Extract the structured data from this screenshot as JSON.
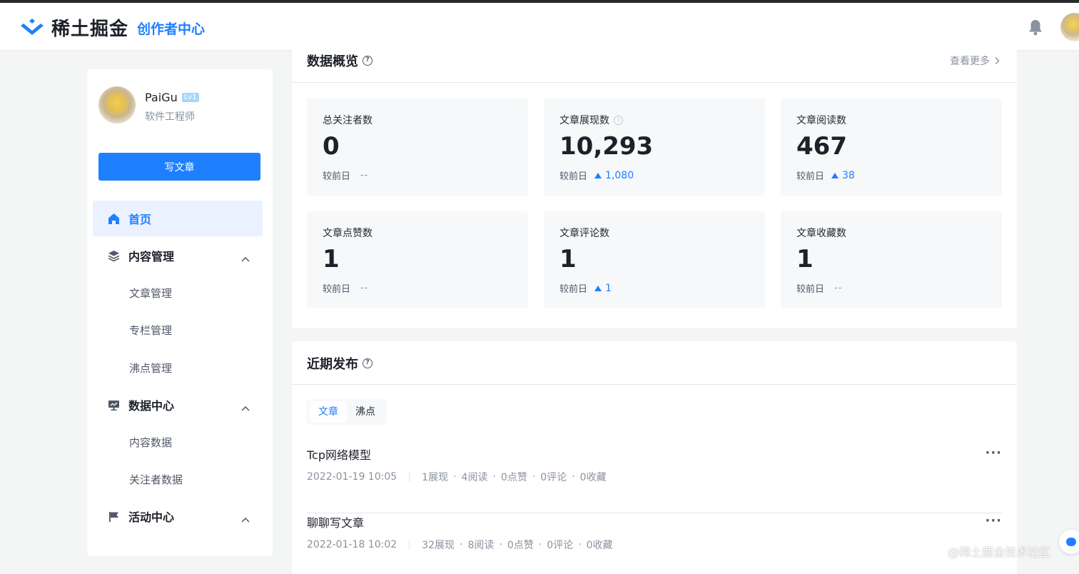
{
  "header": {
    "logo_text": "稀土掘金",
    "subtitle": "创作者中心",
    "brand_color": "#1e80ff"
  },
  "sidebar": {
    "user": {
      "name": "PaiGu",
      "level": "Lv1",
      "title": "软件工程师"
    },
    "write_button": "写文章",
    "nav": [
      {
        "label": "首页",
        "icon": "home-icon",
        "active": true
      },
      {
        "label": "内容管理",
        "icon": "layers-icon",
        "sub": [
          "文章管理",
          "专栏管理",
          "沸点管理"
        ]
      },
      {
        "label": "数据中心",
        "icon": "monitor-chart-icon",
        "sub": [
          "内容数据",
          "关注者数据"
        ]
      },
      {
        "label": "活动中心",
        "icon": "flag-icon"
      }
    ]
  },
  "overview": {
    "title": "数据概览",
    "more": "查看更多",
    "compare_label": "较前日",
    "no_change": "--",
    "cards": [
      {
        "label": "总关注者数",
        "value": "0",
        "delta": null
      },
      {
        "label": "文章展现数",
        "value": "10,293",
        "delta": "1,080",
        "has_help": true
      },
      {
        "label": "文章阅读数",
        "value": "467",
        "delta": "38"
      },
      {
        "label": "文章点赞数",
        "value": "1",
        "delta": null
      },
      {
        "label": "文章评论数",
        "value": "1",
        "delta": "1"
      },
      {
        "label": "文章收藏数",
        "value": "1",
        "delta": null
      }
    ]
  },
  "recent": {
    "title": "近期发布",
    "tabs": [
      "文章",
      "沸点"
    ],
    "articles": [
      {
        "title": "Tcp网络模型",
        "date": "2022-01-19 10:05",
        "stats": [
          "1展现",
          "4阅读",
          "0点赞",
          "0评论",
          "0收藏"
        ]
      },
      {
        "title": "聊聊写文章",
        "date": "2022-01-18 10:02",
        "stats": [
          "32展现",
          "8阅读",
          "0点赞",
          "0评论",
          "0收藏"
        ]
      }
    ]
  },
  "watermark": "@稀土掘金技术社区"
}
